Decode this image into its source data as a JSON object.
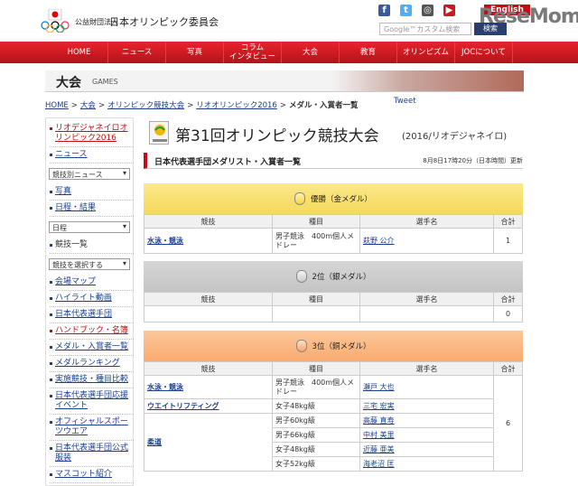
{
  "header": {
    "org_small": "公益財団法人",
    "org_name": "日本オリンピック委員会",
    "english_link": "English",
    "search_placeholder": "Google™カスタム検索",
    "search_button": "検索",
    "watermark": "ReseMom",
    "social": [
      {
        "name": "facebook",
        "glyph": "f",
        "color": "#3b5998"
      },
      {
        "name": "twitter",
        "glyph": "t",
        "color": "#55acee"
      },
      {
        "name": "instagram",
        "glyph": "◎",
        "color": "#555555"
      },
      {
        "name": "youtube",
        "glyph": "▶",
        "color": "#cc181e"
      }
    ]
  },
  "nav": [
    "HOME",
    "ニュース",
    "写真",
    "コラム\nインタビュー",
    "大会",
    "教育",
    "オリンピズム",
    "JOCについて"
  ],
  "band": {
    "title": "大会",
    "subtitle": "GAMES"
  },
  "breadcrumb": [
    "HOME",
    ">",
    "大会",
    ">",
    "オリンピック競技大会",
    ">",
    "リオオリンピック2016",
    ">",
    "メダル・入賞者一覧"
  ],
  "tweet": "Tweet",
  "sidebar": {
    "top_link": "リオデジャネイロオリンピック2016",
    "news_link": "ニュース",
    "select_news": "競技別ニュース",
    "photo_link": "写真",
    "schedule_link": "日程・結果",
    "select_schedule": "日程",
    "events_link": "競技一覧",
    "select_sport": "競技を選択する",
    "items": [
      "会場マップ",
      "ハイライト動画",
      "日本代表選手団"
    ],
    "handbook": "ハンドブック・名簿",
    "items2": [
      "メダル・入賞者一覧",
      "メダルランキング",
      "実施競技・種目比較",
      "日本代表選手団応援イベント",
      "オフィシャルスポーツウエア",
      "日本代表選手団公式服装",
      "マスコット紹介"
    ]
  },
  "main": {
    "title": "第31回オリンピック競技大会",
    "subtitle": "(2016/リオデジャネイロ)",
    "section_title": "日本代表選手団メダリスト・入賞者一覧",
    "updated": "8月8日17時20分（日本時間）更新",
    "columns": [
      "競技",
      "種目",
      "選手名",
      "合計"
    ],
    "gold_label": "優勝（金メダル）",
    "silver_label": "2位（銀メダル）",
    "bronze_label": "3位（銅メダル）",
    "gold_rows": [
      {
        "sport": "水泳・競泳",
        "event": "男子競泳　400m個人メドレー",
        "athlete": "萩野 公介",
        "total": "1"
      }
    ],
    "silver_total": "0",
    "bronze_total": "6",
    "bronze_rows": [
      {
        "sport": "水泳・競泳",
        "event": "男子競泳　400m個人メドレー",
        "athlete": "瀬戸 大也"
      },
      {
        "sport": "ウエイトリフティング",
        "event": "女子48kg級",
        "athlete": "三宅 宏実"
      },
      {
        "sport": "柔道",
        "event": "男子60kg級",
        "athlete": "高藤 直寿"
      },
      {
        "sport": "",
        "event": "男子66kg級",
        "athlete": "中村 美里"
      },
      {
        "sport": "",
        "event": "女子48kg級",
        "athlete": "近藤 亜美"
      },
      {
        "sport": "",
        "event": "女子52kg級",
        "athlete": "海老沼 匡"
      }
    ]
  }
}
